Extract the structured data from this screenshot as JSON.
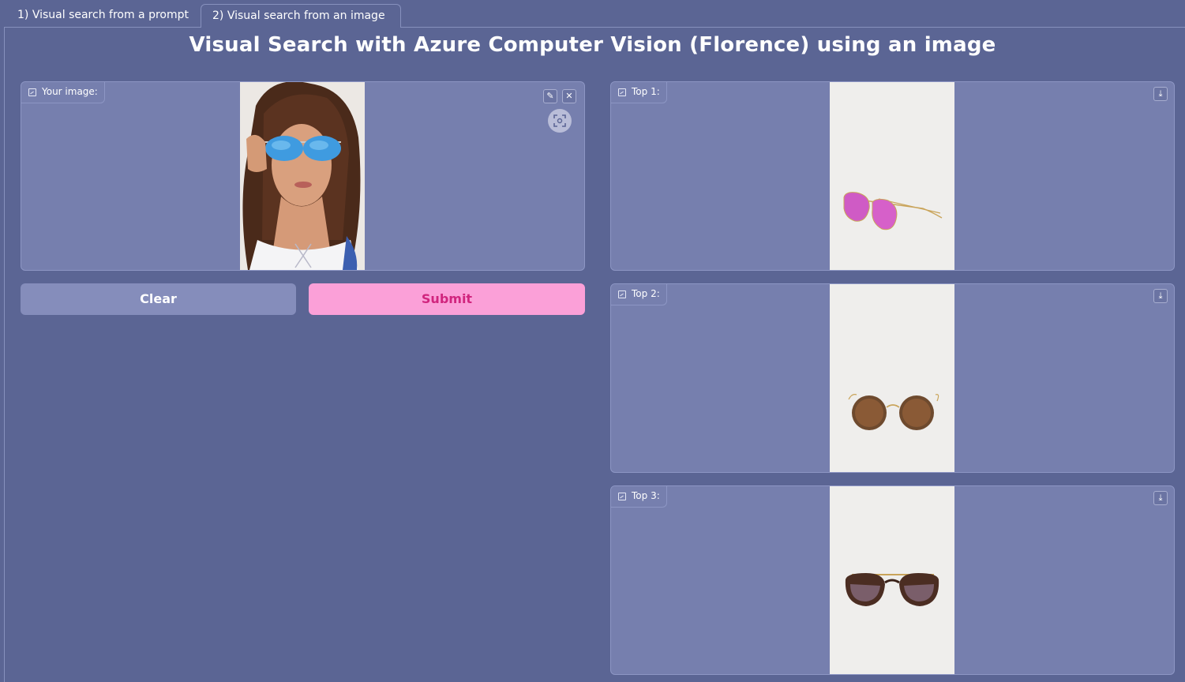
{
  "tabs": [
    {
      "label": "1) Visual search from a prompt",
      "selected": false
    },
    {
      "label": "2) Visual search from an image",
      "selected": true
    }
  ],
  "title": "Visual Search with Azure Computer Vision (Florence) using an image",
  "input_panel": {
    "label": "Your image:",
    "image_description_icon": "woman-with-blue-mirrored-aviator-sunglasses"
  },
  "buttons": {
    "clear": "Clear",
    "submit": "Submit"
  },
  "results": [
    {
      "label": "Top 1:",
      "image_icon": "pink-aviator-sunglasses"
    },
    {
      "label": "Top 2:",
      "image_icon": "round-tortoise-brown-sunglasses"
    },
    {
      "label": "Top 3:",
      "image_icon": "tortoise-gradient-round-sunglasses"
    }
  ],
  "colors": {
    "background": "#5b6594",
    "panel": "#767fae",
    "clear_button": "#858dbb",
    "submit_button": "#fba0d8",
    "submit_text": "#d1257e"
  }
}
